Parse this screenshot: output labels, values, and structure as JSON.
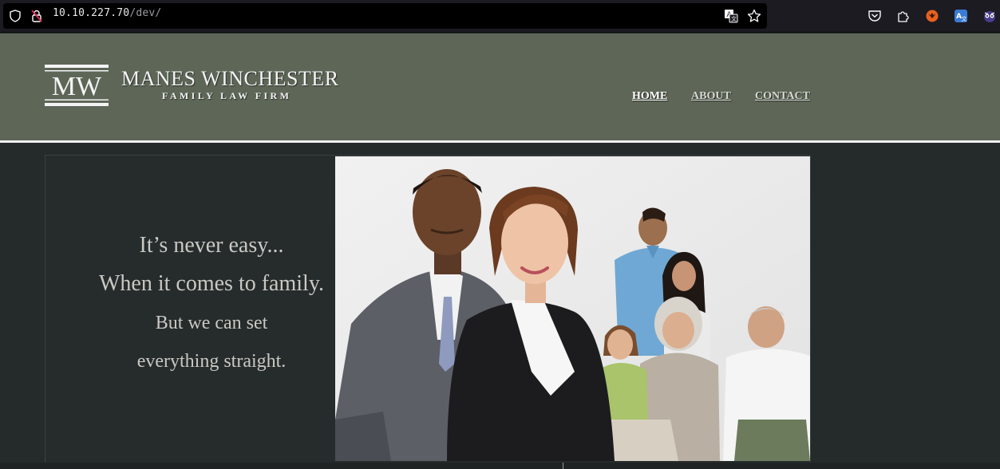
{
  "browser": {
    "url_host": "10.10.227.70",
    "url_path": "/dev/",
    "icons": [
      "shield-icon",
      "insecure-lock-icon",
      "translate-icon",
      "bookmark-star-icon",
      "pocket-icon",
      "extensions-icon",
      "foxyproxy-icon",
      "translate-extension-icon",
      "wappalyzer-icon"
    ]
  },
  "site": {
    "logo_monogram": "MW",
    "title": "MANES WINCHESTER",
    "subtitle": "FAMILY LAW FIRM",
    "nav": {
      "home": "HOME",
      "about": "ABOUT",
      "contact": "CONTACT"
    },
    "hero": {
      "line1": "It’s never easy...",
      "line2": "When it comes to family.",
      "line3": "But we can set",
      "line4": "everything straight."
    }
  },
  "colors": {
    "header_bg": "#5d6657",
    "page_bg": "#252a2b",
    "tagline": "#c9c9c3"
  }
}
